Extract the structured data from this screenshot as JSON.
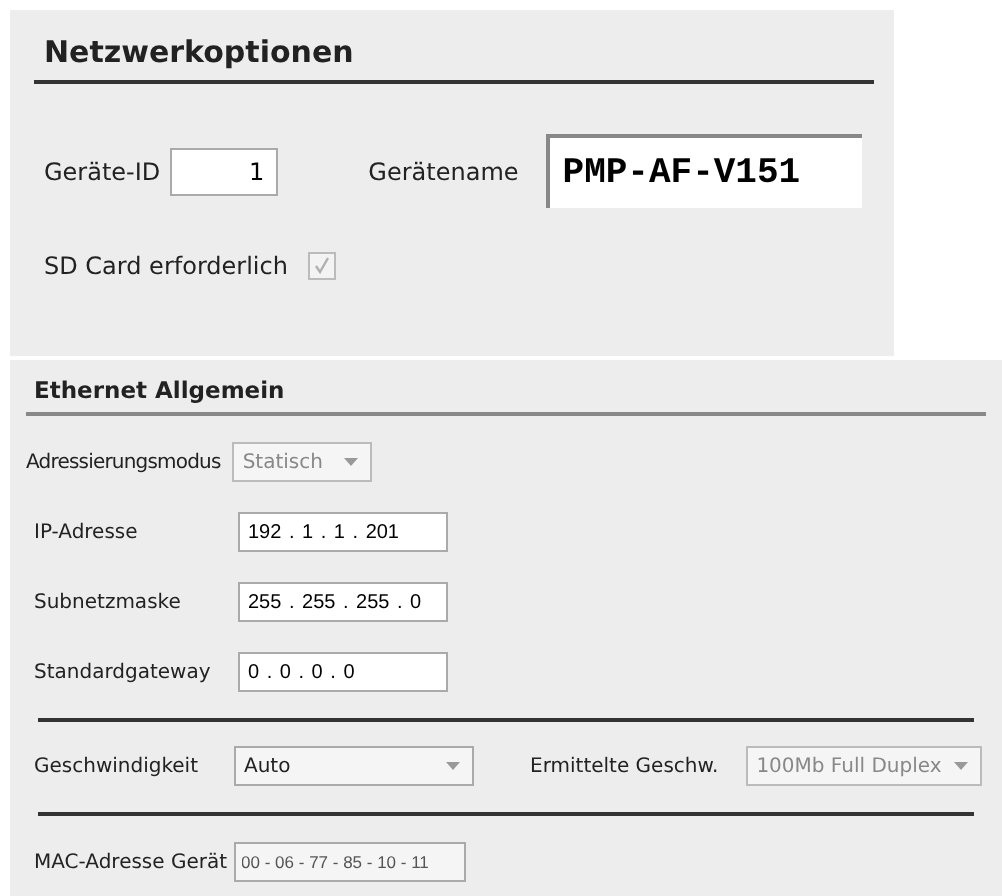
{
  "network_options": {
    "title": "Netzwerkoptionen",
    "device_id": {
      "label": "Geräte-ID",
      "value": "1"
    },
    "device_name": {
      "label": "Gerätename",
      "value": "PMP-AF-V151"
    },
    "sd_card": {
      "label": "SD Card erforderlich",
      "checked": true,
      "disabled": true
    }
  },
  "ethernet": {
    "title": "Ethernet Allgemein",
    "addressing_mode": {
      "label": "Adressierungsmodus",
      "value": "Statisch",
      "disabled": true
    },
    "ip_fields": [
      {
        "label": "IP-Adresse",
        "value": "192 . 1 . 1 . 201"
      },
      {
        "label": "Subnetzmaske",
        "value": "255 . 255 . 255 . 0"
      },
      {
        "label": "Standardgateway",
        "value": "0 . 0 . 0 . 0"
      }
    ],
    "speed": {
      "label": "Geschwindigkeit",
      "value": "Auto",
      "disabled": false
    },
    "detected_speed": {
      "label": "Ermittelte Geschw.",
      "value": "100Mb Full Duplex",
      "disabled": true
    },
    "mac": {
      "label": "MAC-Adresse Gerät",
      "value": "00 - 06 - 77 - 85 - 10 - 11",
      "disabled": true
    }
  }
}
